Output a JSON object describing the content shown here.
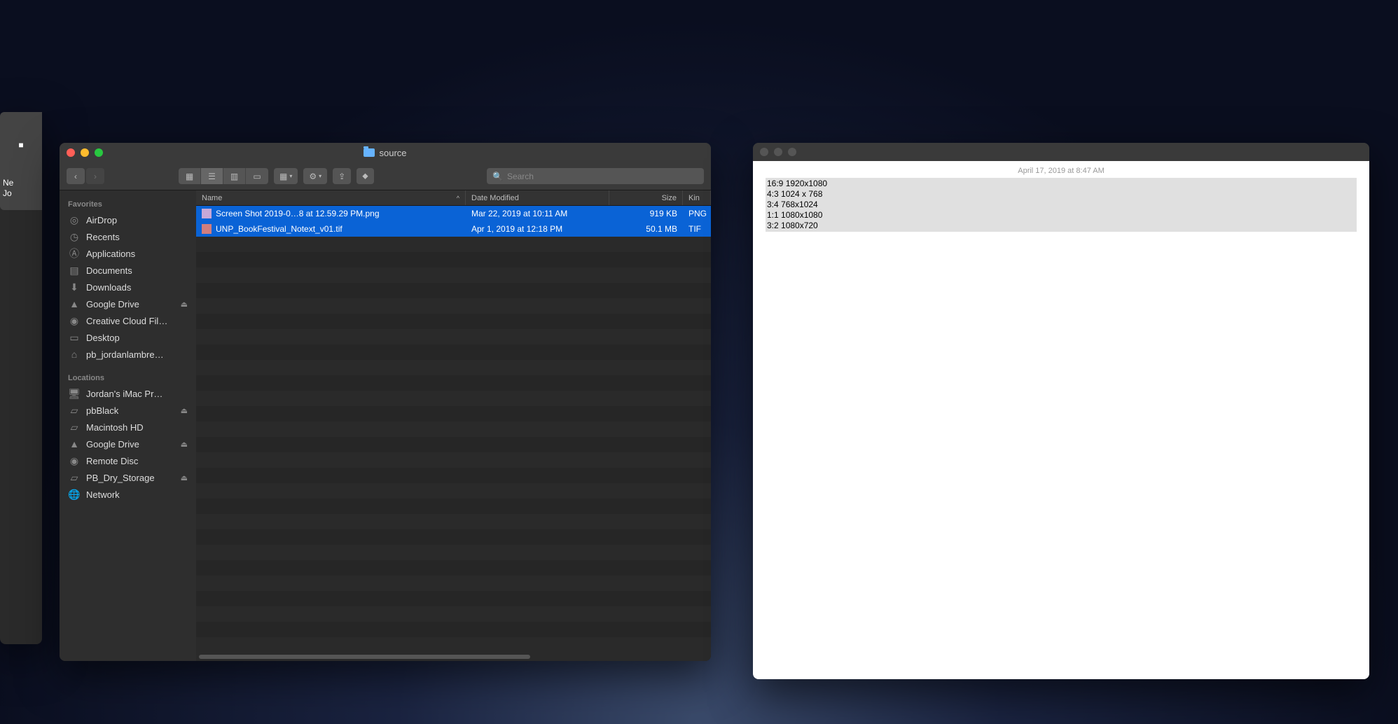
{
  "finder": {
    "title": "source",
    "search_placeholder": "Search",
    "sidebar": {
      "favorites_label": "Favorites",
      "locations_label": "Locations",
      "favorites": [
        {
          "icon": "airdrop",
          "label": "AirDrop"
        },
        {
          "icon": "clock",
          "label": "Recents"
        },
        {
          "icon": "app",
          "label": "Applications"
        },
        {
          "icon": "doc",
          "label": "Documents"
        },
        {
          "icon": "down",
          "label": "Downloads"
        },
        {
          "icon": "gdrive",
          "label": "Google Drive",
          "eject": true
        },
        {
          "icon": "cc",
          "label": "Creative Cloud Fil…"
        },
        {
          "icon": "desk",
          "label": "Desktop"
        },
        {
          "icon": "home",
          "label": "pb_jordanlambre…"
        }
      ],
      "locations": [
        {
          "icon": "computer",
          "label": "Jordan's iMac Pr…"
        },
        {
          "icon": "disk",
          "label": "pbBlack",
          "eject": true
        },
        {
          "icon": "disk",
          "label": "Macintosh HD"
        },
        {
          "icon": "gdrive",
          "label": "Google Drive",
          "eject": true
        },
        {
          "icon": "disc",
          "label": "Remote Disc"
        },
        {
          "icon": "disk",
          "label": "PB_Dry_Storage",
          "eject": true
        },
        {
          "icon": "globe",
          "label": "Network"
        }
      ]
    },
    "columns": {
      "name": "Name",
      "date": "Date Modified",
      "size": "Size",
      "kind": "Kin"
    },
    "files": [
      {
        "name": "Screen Shot 2019-0…8 at 12.59.29 PM.png",
        "date": "Mar 22, 2019 at 10:11 AM",
        "size": "919 KB",
        "kind": "PNG",
        "icon": "png"
      },
      {
        "name": "UNP_BookFestival_Notext_v01.tif",
        "date": "Apr 1, 2019 at 12:18 PM",
        "size": "50.1 MB",
        "kind": "TIF",
        "icon": "tif"
      }
    ]
  },
  "notes": {
    "date": "April 17, 2019 at 8:47 AM",
    "lines": [
      "16:9 1920x1080",
      "4:3 1024 x 768",
      "3:4 768x1024",
      "1:1 1080x1080",
      "3:2 1080x720"
    ]
  },
  "partial": {
    "line1": "Ne",
    "line2": "Jo"
  }
}
